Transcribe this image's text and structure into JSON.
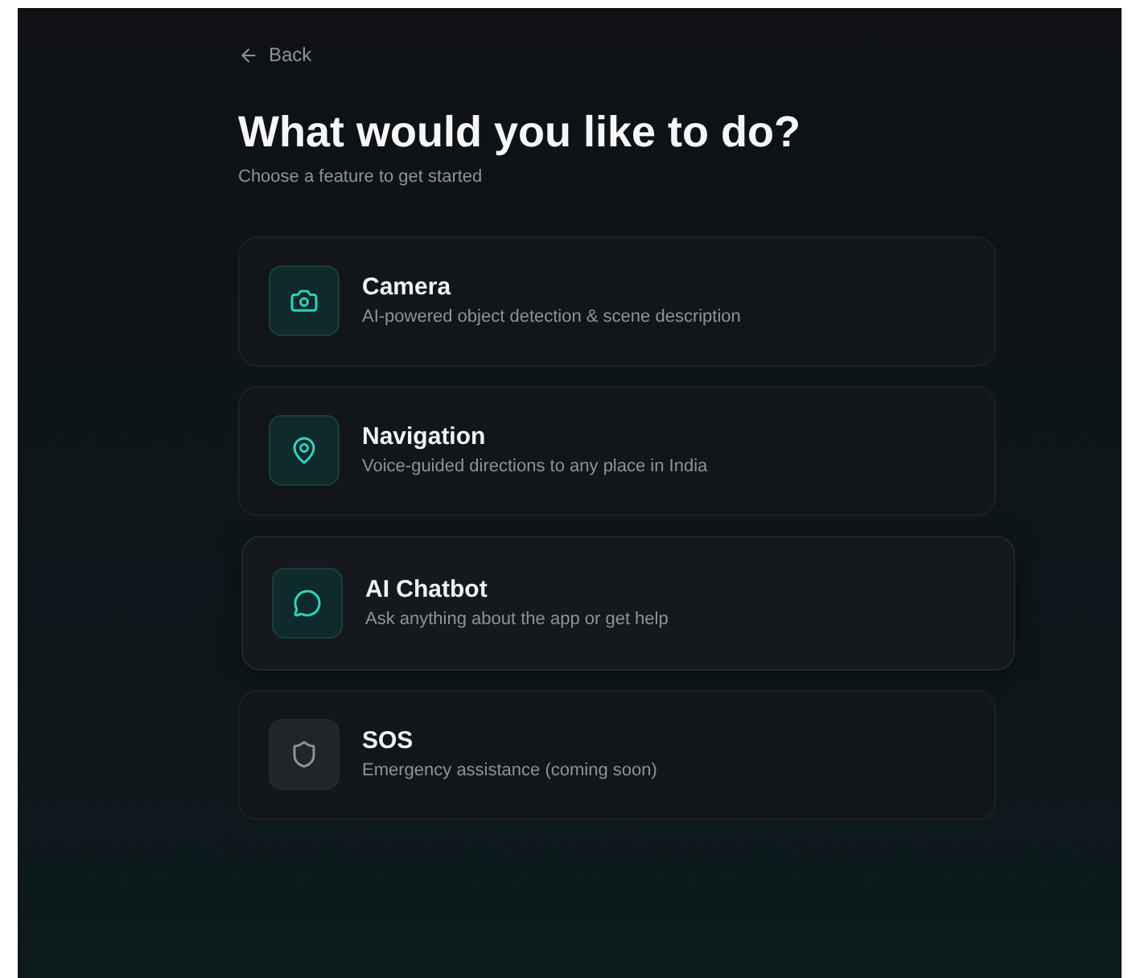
{
  "back_link": {
    "label": "Back"
  },
  "heading": "What would you like to do?",
  "subheading": "Choose a feature to get started",
  "features": [
    {
      "title": "Camera",
      "description": "AI-powered object detection & scene description",
      "disabled": false,
      "hovered": false
    },
    {
      "title": "Navigation",
      "description": "Voice-guided directions to any place in India",
      "disabled": false,
      "hovered": false
    },
    {
      "title": "AI Chatbot",
      "description": "Ask anything about the app or get help",
      "disabled": false,
      "hovered": true
    },
    {
      "title": "SOS",
      "description": "Emergency assistance (coming soon)",
      "disabled": true,
      "hovered": false
    }
  ]
}
